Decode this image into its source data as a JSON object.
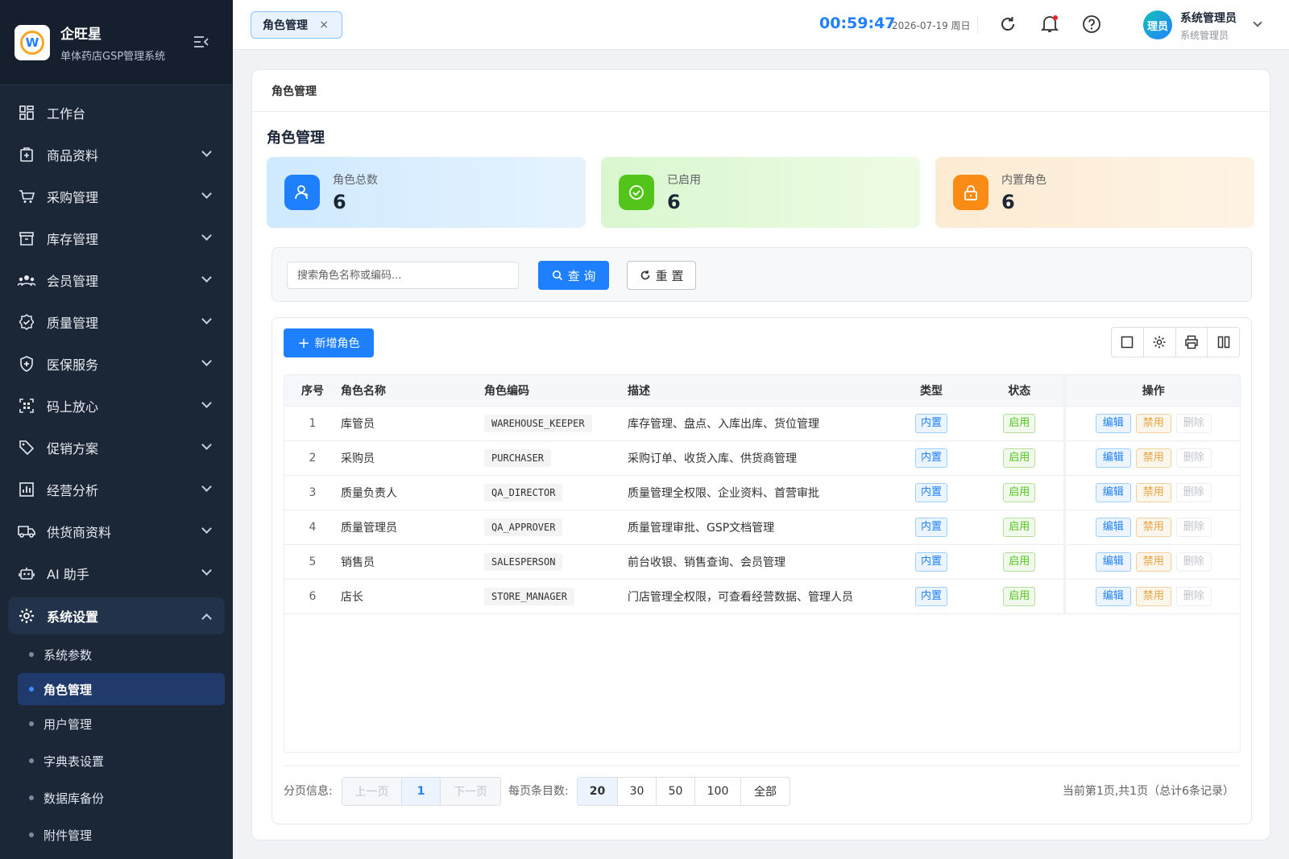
{
  "app": {
    "name": "企旺星",
    "subtitle": "单体药店GSP管理系统"
  },
  "sidebar": {
    "items": [
      {
        "label": "工作台",
        "icon": "dashboard-icon"
      },
      {
        "label": "商品资料",
        "icon": "product-icon"
      },
      {
        "label": "采购管理",
        "icon": "cart-icon"
      },
      {
        "label": "库存管理",
        "icon": "inventory-icon"
      },
      {
        "label": "会员管理",
        "icon": "members-icon"
      },
      {
        "label": "质量管理",
        "icon": "quality-icon"
      },
      {
        "label": "医保服务",
        "icon": "shield-icon"
      },
      {
        "label": "码上放心",
        "icon": "qrcode-icon"
      },
      {
        "label": "促销方案",
        "icon": "tag-icon"
      },
      {
        "label": "经营分析",
        "icon": "chart-icon"
      },
      {
        "label": "供货商资料",
        "icon": "truck-icon"
      },
      {
        "label": "AI 助手",
        "icon": "robot-icon"
      },
      {
        "label": "系统设置",
        "icon": "gear-icon"
      }
    ],
    "sub_items": [
      {
        "label": "系统参数"
      },
      {
        "label": "角色管理"
      },
      {
        "label": "用户管理"
      },
      {
        "label": "字典表设置"
      },
      {
        "label": "数据库备份"
      },
      {
        "label": "附件管理"
      }
    ]
  },
  "topbar": {
    "tab_label": "角色管理",
    "tab_close": "×",
    "clock": "00:59:47",
    "date": "2026-07-19 周日",
    "avatar_text": "理员",
    "user_name": "系统管理员",
    "user_role": "系统管理员"
  },
  "page": {
    "card_header": "角色管理",
    "title": "角色管理",
    "stats": [
      {
        "label": "角色总数",
        "value": "6"
      },
      {
        "label": "已启用",
        "value": "6"
      },
      {
        "label": "内置角色",
        "value": "6"
      }
    ],
    "search": {
      "placeholder": "搜索角色名称或编码...",
      "query_label": "查 询",
      "reset_label": "重 置"
    },
    "add_label": "新增角色",
    "table": {
      "headers": [
        "序号",
        "角色名称",
        "角色编码",
        "描述",
        "类型",
        "状态",
        "操作"
      ],
      "rows": [
        {
          "no": "1",
          "name": "库管员",
          "code": "WAREHOUSE_KEEPER",
          "desc": "库存管理、盘点、入库出库、货位管理",
          "type": "内置",
          "status": "启用"
        },
        {
          "no": "2",
          "name": "采购员",
          "code": "PURCHASER",
          "desc": "采购订单、收货入库、供货商管理",
          "type": "内置",
          "status": "启用"
        },
        {
          "no": "3",
          "name": "质量负责人",
          "code": "QA_DIRECTOR",
          "desc": "质量管理全权限、企业资料、首营审批",
          "type": "内置",
          "status": "启用"
        },
        {
          "no": "4",
          "name": "质量管理员",
          "code": "QA_APPROVER",
          "desc": "质量管理审批、GSP文档管理",
          "type": "内置",
          "status": "启用"
        },
        {
          "no": "5",
          "name": "销售员",
          "code": "SALESPERSON",
          "desc": "前台收银、销售查询、会员管理",
          "type": "内置",
          "status": "启用"
        },
        {
          "no": "6",
          "name": "店长",
          "code": "STORE_MANAGER",
          "desc": "门店管理全权限，可查看经营数据、管理人员",
          "type": "内置",
          "status": "启用"
        }
      ],
      "actions": {
        "edit": "编辑",
        "disable": "禁用",
        "delete": "删除"
      }
    },
    "pager": {
      "label": "分页信息:",
      "prev": "上一页",
      "current": "1",
      "next": "下一页",
      "size_label": "每页条目数:",
      "sizes": [
        "20",
        "30",
        "50",
        "100",
        "全部"
      ],
      "info": "当前第1页,共1页（总计6条记录）"
    }
  },
  "colors": {
    "accent": "#1e80ff",
    "sidebar_bg": "#1b2637",
    "success": "#52c41a",
    "warning": "#f5a623"
  }
}
